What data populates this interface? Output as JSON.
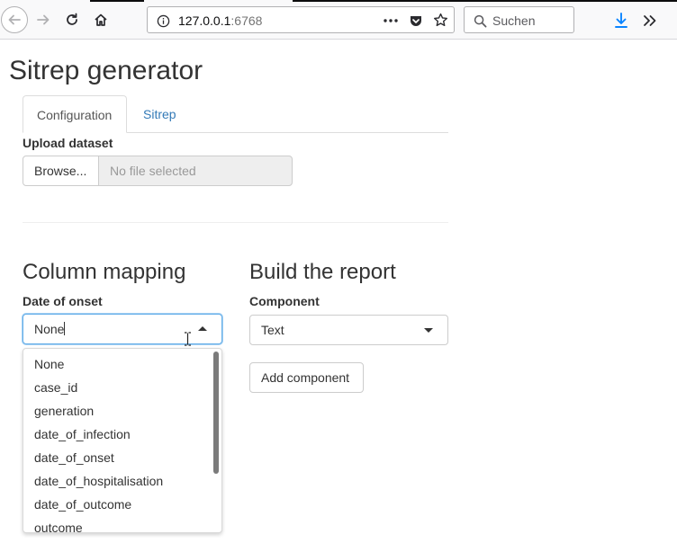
{
  "browser": {
    "url_host": "127.0.0.1",
    "url_port": ":6768",
    "search_placeholder": "Suchen",
    "more_icon": "more-dots-icon",
    "pocket_icon": "pocket-icon",
    "bookmark_icon": "star-icon",
    "downloads_icon": "download-arrow-icon",
    "overflow_icon": "double-chevron-icon",
    "accent_color": "#0a84ff"
  },
  "page": {
    "title": "Sitrep generator"
  },
  "tabs": [
    {
      "label": "Configuration",
      "active": true
    },
    {
      "label": "Sitrep",
      "active": false
    }
  ],
  "upload": {
    "label": "Upload dataset",
    "browse_label": "Browse...",
    "file_placeholder": "No file selected"
  },
  "column_mapping": {
    "heading": "Column mapping",
    "field_label": "Date of onset",
    "selected_value": "None",
    "options": [
      "None",
      "case_id",
      "generation",
      "date_of_infection",
      "date_of_onset",
      "date_of_hospitalisation",
      "date_of_outcome",
      "outcome"
    ]
  },
  "build_report": {
    "heading": "Build the report",
    "component_label": "Component",
    "component_value": "Text",
    "add_button_label": "Add component"
  },
  "colors": {
    "link": "#337ab7",
    "focus_border": "#66afe9"
  }
}
